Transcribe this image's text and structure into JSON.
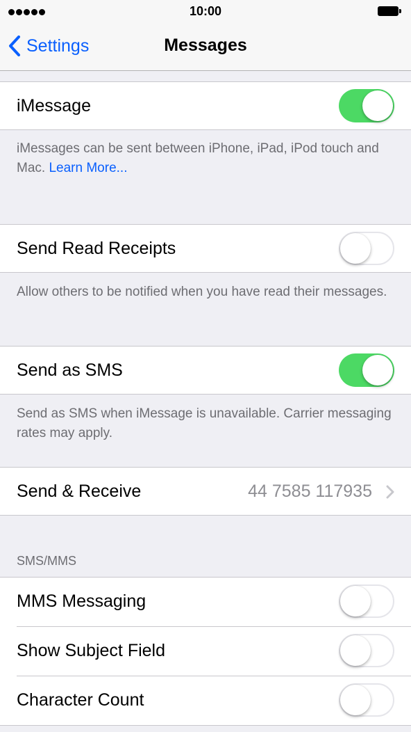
{
  "status_bar": {
    "time": "10:00",
    "signal_icon": "signal-dots-icon",
    "battery_icon": "battery-icon"
  },
  "nav": {
    "back_label": "Settings",
    "title": "Messages"
  },
  "imessage": {
    "label": "iMessage",
    "enabled": true,
    "footer_text": "iMessages can be sent between iPhone, iPad, iPod touch and Mac.",
    "footer_link": "Learn More..."
  },
  "read_receipts": {
    "label": "Send Read Receipts",
    "enabled": false,
    "footer_text": "Allow others to be notified when you have read their messages."
  },
  "send_sms": {
    "label": "Send as SMS",
    "enabled": true,
    "footer_text": "Send as SMS when iMessage is unavailable. Carrier messaging rates may apply."
  },
  "send_receive": {
    "label": "Send & Receive",
    "value": "44 7585 117935"
  },
  "sms_mms": {
    "header": "SMS/MMS",
    "items": [
      {
        "label": "MMS Messaging",
        "enabled": false
      },
      {
        "label": "Show Subject Field",
        "enabled": false
      },
      {
        "label": "Character Count",
        "enabled": false
      }
    ]
  },
  "colors": {
    "accent": "#0a60fe",
    "toggle_on": "#4cd964",
    "background": "#efeff4"
  }
}
